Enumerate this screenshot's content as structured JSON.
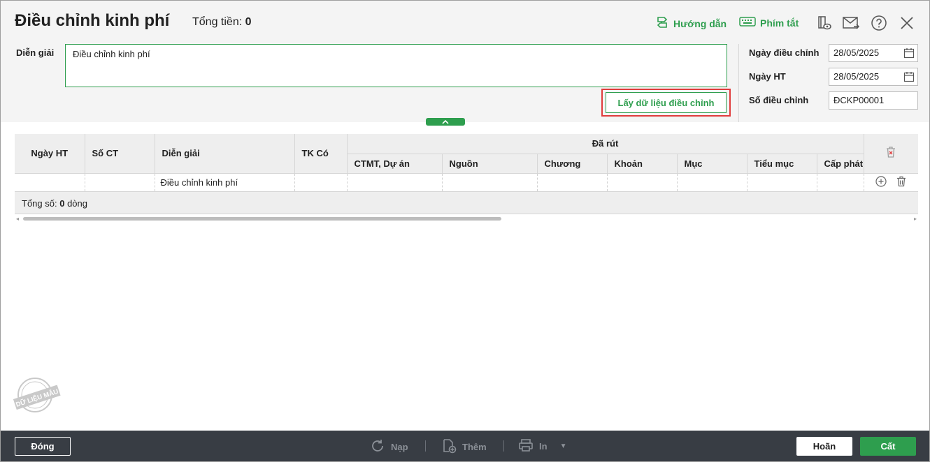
{
  "header": {
    "title": "Điều chỉnh kinh phí",
    "total_label": "Tổng tiền:",
    "total_value": "0",
    "guide_label": "Hướng dẫn",
    "shortcut_label": "Phím tắt"
  },
  "form": {
    "description_label": "Diễn giải",
    "description_value": "Điều chỉnh kinh phí",
    "get_data_button": "Lấy dữ liệu điều chỉnh",
    "adjust_date_label": "Ngày điều chỉnh",
    "adjust_date_value": "28/05/2025",
    "posting_date_label": "Ngày HT",
    "posting_date_value": "28/05/2025",
    "adjust_no_label": "Số điều chỉnh",
    "adjust_no_value": "ĐCKP00001"
  },
  "grid": {
    "columns": {
      "posting_date": "Ngày HT",
      "doc_no": "Số CT",
      "description": "Diễn giải",
      "credit_account": "TK Có",
      "group": "Đã rút",
      "program": "CTMT, Dự án",
      "source": "Nguồn",
      "chapter": "Chương",
      "section": "Khoản",
      "item": "Mục",
      "sub_item": "Tiểu mục",
      "allocation": "Cấp phát"
    },
    "rows": [
      {
        "posting_date": "",
        "doc_no": "",
        "description": "Điều chỉnh kinh phí",
        "credit_account": "",
        "program": "",
        "source": "",
        "chapter": "",
        "section": "",
        "item": "",
        "sub_item": "",
        "allocation": ""
      }
    ],
    "summary_prefix": "Tổng số:",
    "summary_count": "0",
    "summary_suffix": "dòng"
  },
  "stamp_text": "DỮ LIỆU MẪU",
  "footer": {
    "close_label": "Đóng",
    "reload_label": "Nạp",
    "add_label": "Thêm",
    "print_label": "In",
    "cancel_label": "Hoãn",
    "save_label": "Cất"
  },
  "colors": {
    "accent": "#2e9e4e",
    "highlight_border": "#e03c3c",
    "bottom_bar": "#383d44"
  }
}
